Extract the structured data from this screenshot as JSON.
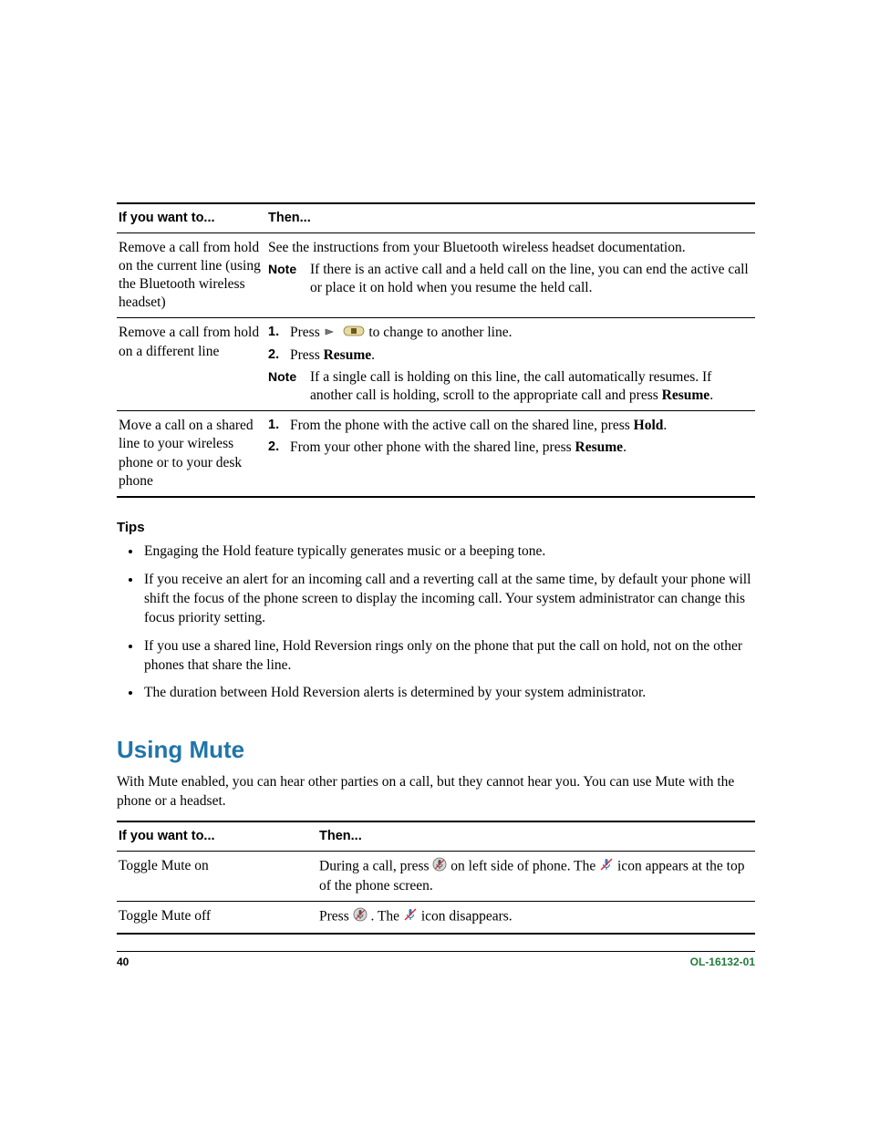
{
  "table1": {
    "head": {
      "c1": "If you want to...",
      "c2": "Then..."
    },
    "row1": {
      "task": "Remove a call from hold on the current line (using the Bluetooth wireless headset)",
      "line1": "See the instructions from your Bluetooth wireless headset documentation.",
      "note_label": "Note",
      "note_text": "If there is an active call and a held call on the line, you can end the active call or place it on hold when you resume the held call."
    },
    "row2": {
      "task": "Remove a call from hold on a different line",
      "s1num": "1.",
      "s1a": "Press ",
      "s1b": " to change to another line.",
      "s2num": "2.",
      "s2a": "Press ",
      "s2b": "Resume",
      "s2c": ".",
      "note_label": "Note",
      "note_a": "If a single call is holding on this line, the call automatically resumes. If another call is holding, scroll to the appropriate call and press ",
      "note_b": "Resume",
      "note_c": "."
    },
    "row3": {
      "task": "Move a call on a shared line to your wireless phone or to your desk phone",
      "s1num": "1.",
      "s1a": "From the phone with the active call on the shared line, press ",
      "s1b": "Hold",
      "s1c": ".",
      "s2num": "2.",
      "s2a": "From your other phone with the shared line, press ",
      "s2b": "Resume",
      "s2c": "."
    }
  },
  "tips_head": "Tips",
  "tips": [
    "Engaging the Hold feature typically generates music or a beeping tone.",
    "If you receive an alert for an incoming call and a reverting call at the same time, by default your phone will shift the focus of the phone screen to display the incoming call. Your system administrator can change this focus priority setting.",
    "If you use a shared line, Hold Reversion rings only on the phone that put the call on hold, not on the other phones that share the line.",
    "The duration between Hold Reversion alerts is determined by your system administrator."
  ],
  "section_heading": "Using Mute",
  "section_intro": "With Mute enabled, you can hear other parties on a call, but they cannot hear you. You can use Mute with the phone or a headset.",
  "table2": {
    "head": {
      "c1": "If you want to...",
      "c2": "Then..."
    },
    "row1": {
      "task": "Toggle Mute on",
      "a": "During a call, press ",
      "b": " on left side of phone. The ",
      "c": " icon appears at the top of the phone screen."
    },
    "row2": {
      "task": "Toggle Mute off",
      "a": "Press ",
      "b": ". The ",
      "c": " icon disappears."
    }
  },
  "footer": {
    "page": "40",
    "docnum": "OL-16132-01"
  }
}
